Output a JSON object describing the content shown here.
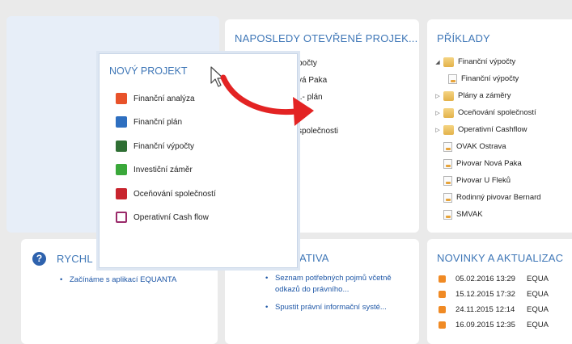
{
  "recent": {
    "title": "NAPOSLEDY OTEVŘENÉ PROJEK...",
    "items": [
      "počty",
      "vá Paka",
      "..- plán",
      "",
      "společnosti"
    ]
  },
  "examples": {
    "title": "PŘÍKLADY",
    "items": [
      {
        "label": "Finanční výpočty",
        "icon": "folder-icon",
        "toggle": "◢"
      },
      {
        "label": "Finanční výpočty",
        "icon": "document-icon",
        "toggle": ""
      },
      {
        "label": "Plány a záměry",
        "icon": "folder-icon",
        "toggle": "▷"
      },
      {
        "label": "Oceňování společností",
        "icon": "folder-icon",
        "toggle": "▷"
      },
      {
        "label": "Operativní Cashflow",
        "icon": "folder-icon",
        "toggle": "▷"
      },
      {
        "label": "OVAK Ostrava",
        "icon": "document-icon",
        "toggle": ""
      },
      {
        "label": "Pivovar Nová Paka",
        "icon": "document-icon",
        "toggle": ""
      },
      {
        "label": "Pivovar U Fleků",
        "icon": "document-icon",
        "toggle": ""
      },
      {
        "label": "Rodinný pivovar Bernard",
        "icon": "document-icon",
        "toggle": ""
      },
      {
        "label": "SMVAK",
        "icon": "document-icon",
        "toggle": ""
      }
    ]
  },
  "quick": {
    "title": "RYCHL",
    "link": "Začínáme s aplikací EQUANTA"
  },
  "legislation": {
    "title": "ATIVA",
    "links": [
      "Seznam potřebných pojmů včetně odkazů do právního...",
      "Spustit právní informační systé..."
    ]
  },
  "news": {
    "title": "NOVINKY A AKTUALIZAC",
    "items": [
      {
        "date": "05.02.2016 13:29",
        "source": "EQUA"
      },
      {
        "date": "15.12.2015 17:32",
        "source": "EQUA"
      },
      {
        "date": "24.11.2015 12:14",
        "source": "EQUA"
      },
      {
        "date": "16.09.2015 12:35",
        "source": "EQUA"
      }
    ]
  },
  "new_project": {
    "title": "NOVÝ PROJEKT",
    "items": [
      {
        "label": "Finanční analýza",
        "icon": "financial-analysis-icon",
        "color": "#e8522a"
      },
      {
        "label": "Finanční plán",
        "icon": "financial-plan-icon",
        "color": "#2e6fc0"
      },
      {
        "label": "Finanční výpočty",
        "icon": "financial-calc-icon",
        "color": "#2f6f34"
      },
      {
        "label": "Investiční záměr",
        "icon": "investment-icon",
        "color": "#3aa83a"
      },
      {
        "label": "Oceňování společností",
        "icon": "valuation-icon",
        "color": "#c8242e"
      },
      {
        "label": "Operativní Cash flow",
        "icon": "cashflow-icon",
        "color": "#9a2a6a"
      }
    ]
  },
  "colors": {
    "accent": "#3f77b7",
    "link": "#1d56a6",
    "arrow": "#e32323"
  }
}
